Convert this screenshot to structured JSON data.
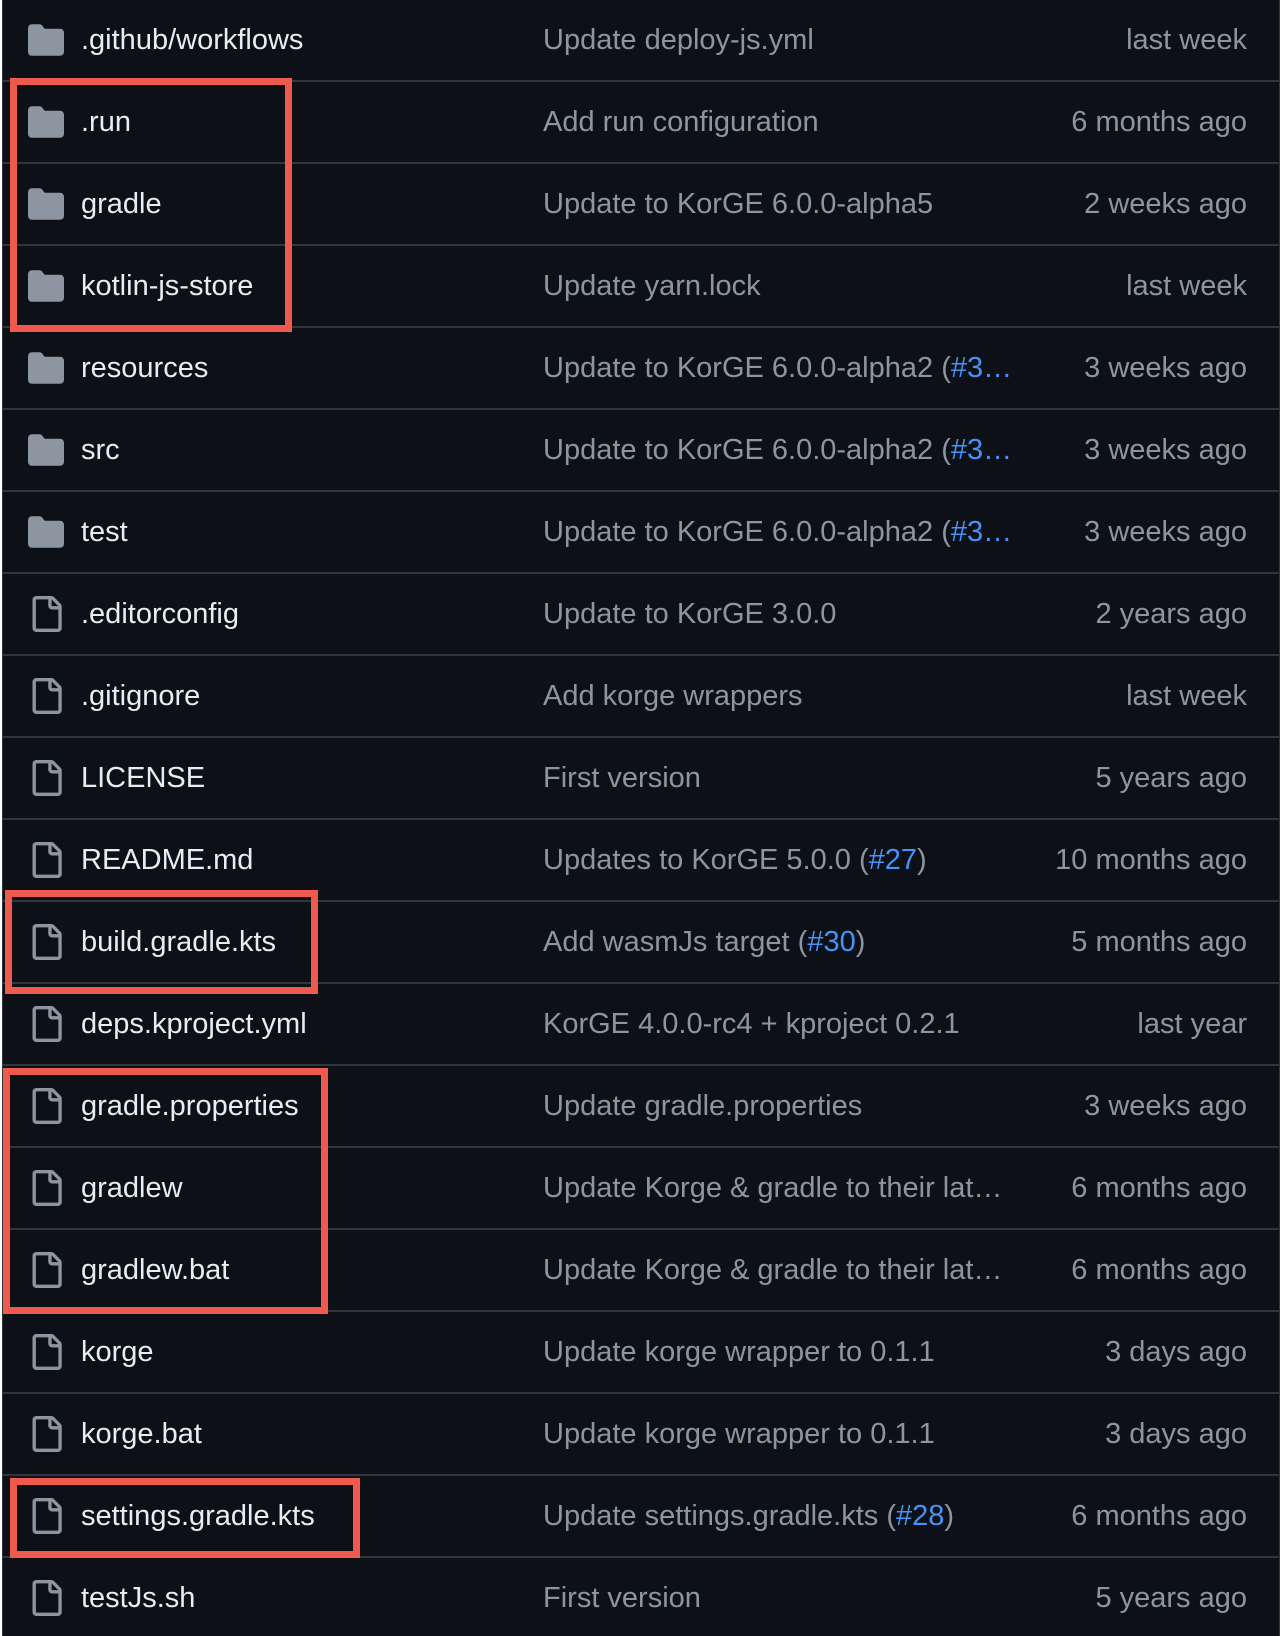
{
  "colors": {
    "background": "#0d1117",
    "border": "#30363d",
    "name_text": "#e6edf3",
    "muted_text": "#8d96a0",
    "link": "#4493f8",
    "highlight": "#ef5a4c",
    "folder_icon": "#8d96a0"
  },
  "rows": [
    {
      "type": "folder",
      "icon": "folder-icon",
      "name": ".github/workflows",
      "msg": "Update deploy-js.yml",
      "pr": "",
      "msg_end": "",
      "age": "last week"
    },
    {
      "type": "folder",
      "icon": "folder-icon",
      "name": ".run",
      "msg": "Add run configuration",
      "pr": "",
      "msg_end": "",
      "age": "6 months ago"
    },
    {
      "type": "folder",
      "icon": "folder-icon",
      "name": "gradle",
      "msg": "Update to KorGE 6.0.0-alpha5",
      "pr": "",
      "msg_end": "",
      "age": "2 weeks ago"
    },
    {
      "type": "folder",
      "icon": "folder-icon",
      "name": "kotlin-js-store",
      "msg": "Update yarn.lock",
      "pr": "",
      "msg_end": "",
      "age": "last week"
    },
    {
      "type": "folder",
      "icon": "folder-icon",
      "name": "resources",
      "msg": "Update to KorGE 6.0.0-alpha2 (",
      "pr": "#3…",
      "msg_end": "",
      "age": "3 weeks ago"
    },
    {
      "type": "folder",
      "icon": "folder-icon",
      "name": "src",
      "msg": "Update to KorGE 6.0.0-alpha2 (",
      "pr": "#3…",
      "msg_end": "",
      "age": "3 weeks ago"
    },
    {
      "type": "folder",
      "icon": "folder-icon",
      "name": "test",
      "msg": "Update to KorGE 6.0.0-alpha2 (",
      "pr": "#3…",
      "msg_end": "",
      "age": "3 weeks ago"
    },
    {
      "type": "file",
      "icon": "file-icon",
      "name": ".editorconfig",
      "msg": "Update to KorGE 3.0.0",
      "pr": "",
      "msg_end": "",
      "age": "2 years ago"
    },
    {
      "type": "file",
      "icon": "file-icon",
      "name": ".gitignore",
      "msg": "Add korge wrappers",
      "pr": "",
      "msg_end": "",
      "age": "last week"
    },
    {
      "type": "file",
      "icon": "file-icon",
      "name": "LICENSE",
      "msg": "First version",
      "pr": "",
      "msg_end": "",
      "age": "5 years ago"
    },
    {
      "type": "file",
      "icon": "file-icon",
      "name": "README.md",
      "msg": "Updates to KorGE 5.0.0 (",
      "pr": "#27",
      "msg_end": ")",
      "age": "10 months ago"
    },
    {
      "type": "file",
      "icon": "file-icon",
      "name": "build.gradle.kts",
      "msg": "Add wasmJs target (",
      "pr": "#30",
      "msg_end": ")",
      "age": "5 months ago"
    },
    {
      "type": "file",
      "icon": "file-icon",
      "name": "deps.kproject.yml",
      "msg": "KorGE 4.0.0-rc4 + kproject 0.2.1",
      "pr": "",
      "msg_end": "",
      "age": "last year"
    },
    {
      "type": "file",
      "icon": "file-icon",
      "name": "gradle.properties",
      "msg": "Update gradle.properties",
      "pr": "",
      "msg_end": "",
      "age": "3 weeks ago"
    },
    {
      "type": "file",
      "icon": "file-icon",
      "name": "gradlew",
      "msg": "Update Korge & gradle to their lat…",
      "pr": "",
      "msg_end": "",
      "age": "6 months ago"
    },
    {
      "type": "file",
      "icon": "file-icon",
      "name": "gradlew.bat",
      "msg": "Update Korge & gradle to their lat…",
      "pr": "",
      "msg_end": "",
      "age": "6 months ago"
    },
    {
      "type": "file",
      "icon": "file-icon",
      "name": "korge",
      "msg": "Update korge wrapper to 0.1.1",
      "pr": "",
      "msg_end": "",
      "age": "3 days ago"
    },
    {
      "type": "file",
      "icon": "file-icon",
      "name": "korge.bat",
      "msg": "Update korge wrapper to 0.1.1",
      "pr": "",
      "msg_end": "",
      "age": "3 days ago"
    },
    {
      "type": "file",
      "icon": "file-icon",
      "name": "settings.gradle.kts",
      "msg": "Update settings.gradle.kts (",
      "pr": "#28",
      "msg_end": ")",
      "age": "6 months ago"
    },
    {
      "type": "file",
      "icon": "file-icon",
      "name": "testJs.sh",
      "msg": "First version",
      "pr": "",
      "msg_end": "",
      "age": "5 years ago"
    }
  ],
  "highlight_groups": [
    {
      "rows": [
        1,
        3
      ]
    },
    {
      "rows": [
        11,
        11
      ]
    },
    {
      "rows": [
        13,
        15
      ]
    },
    {
      "rows": [
        18,
        18
      ]
    }
  ]
}
